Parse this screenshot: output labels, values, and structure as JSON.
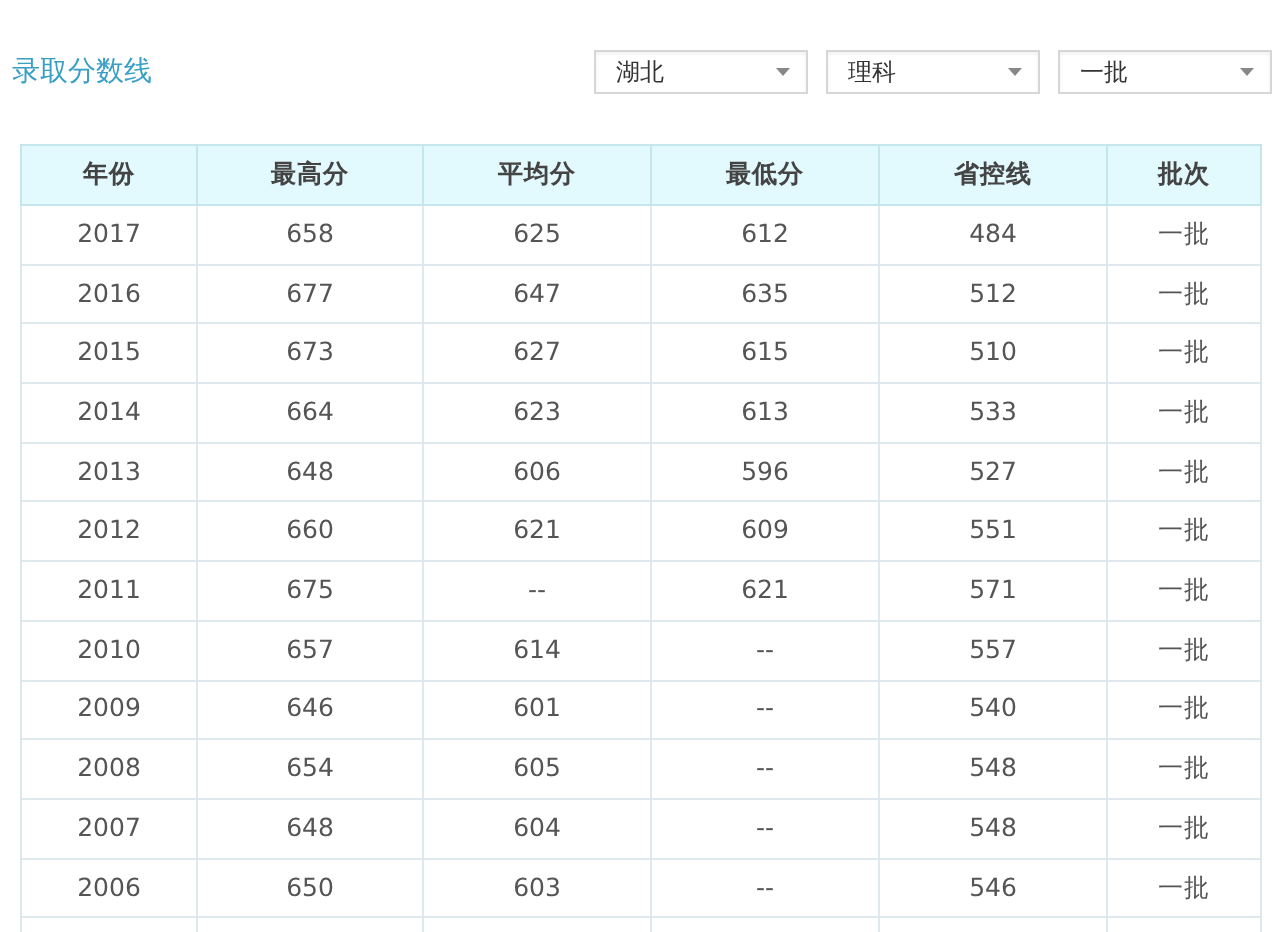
{
  "title": "录取分数线",
  "filters": [
    {
      "value": "湖北"
    },
    {
      "value": "理科"
    },
    {
      "value": "一批"
    }
  ],
  "table": {
    "columns": [
      "年份",
      "最高分",
      "平均分",
      "最低分",
      "省控线",
      "批次"
    ],
    "rows": [
      [
        "2017",
        "658",
        "625",
        "612",
        "484",
        "一批"
      ],
      [
        "2016",
        "677",
        "647",
        "635",
        "512",
        "一批"
      ],
      [
        "2015",
        "673",
        "627",
        "615",
        "510",
        "一批"
      ],
      [
        "2014",
        "664",
        "623",
        "613",
        "533",
        "一批"
      ],
      [
        "2013",
        "648",
        "606",
        "596",
        "527",
        "一批"
      ],
      [
        "2012",
        "660",
        "621",
        "609",
        "551",
        "一批"
      ],
      [
        "2011",
        "675",
        "--",
        "621",
        "571",
        "一批"
      ],
      [
        "2010",
        "657",
        "614",
        "--",
        "557",
        "一批"
      ],
      [
        "2009",
        "646",
        "601",
        "--",
        "540",
        "一批"
      ],
      [
        "2008",
        "654",
        "605",
        "--",
        "548",
        "一批"
      ],
      [
        "2007",
        "648",
        "604",
        "--",
        "548",
        "一批"
      ],
      [
        "2006",
        "650",
        "603",
        "--",
        "546",
        "一批"
      ]
    ]
  }
}
